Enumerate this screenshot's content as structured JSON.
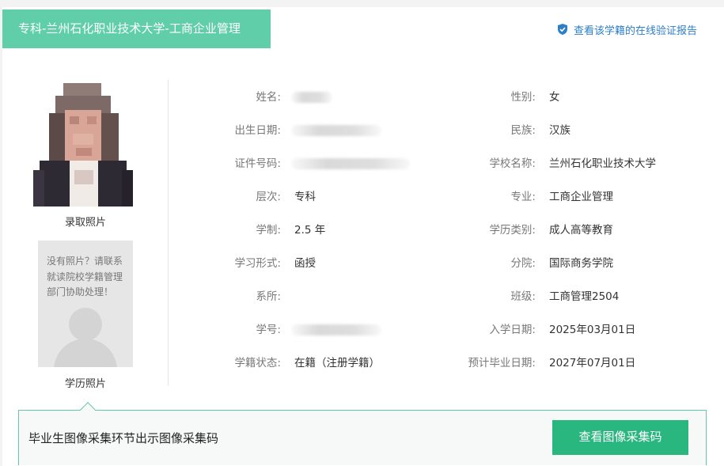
{
  "header": {
    "title": "专科-兰州石化职业技术大学-工商企业管理",
    "verify_link": "查看该学籍的在线验证报告",
    "verify_icon": "shield-check-icon"
  },
  "photos": {
    "admission_caption": "录取照片",
    "education_caption": "学历照片",
    "no_photo_msg": "没有照片？请联系就读院校学籍管理部门协助处理！"
  },
  "fields": {
    "name_label": "姓名:",
    "gender_label": "性别:",
    "gender_value": "女",
    "birth_label": "出生日期:",
    "ethnicity_label": "民族:",
    "ethnicity_value": "汉族",
    "id_label": "证件号码:",
    "school_label": "学校名称:",
    "school_value": "兰州石化职业技术大学",
    "level_label": "层次:",
    "level_value": "专科",
    "major_label": "专业:",
    "major_value": "工商企业管理",
    "duration_label": "学制:",
    "duration_value": "2.5 年",
    "edu_type_label": "学历类别:",
    "edu_type_value": "成人高等教育",
    "study_form_label": "学习形式:",
    "study_form_value": "函授",
    "branch_label": "分院:",
    "branch_value": "国际商务学院",
    "dept_label": "系所:",
    "class_label": "班级:",
    "class_value": "工商管理2504",
    "student_no_label": "学号:",
    "enroll_date_label": "入学日期:",
    "enroll_date_value": "2025年03月01日",
    "status_label": "学籍状态:",
    "status_value": "在籍（注册学籍）",
    "grad_date_label": "预计毕业日期:",
    "grad_date_value": "2027年07月01日"
  },
  "bottom": {
    "text": "毕业生图像采集环节出示图像采集码",
    "button": "查看图像采集码"
  },
  "colors": {
    "accent": "#5fcea9",
    "button": "#2ab67f",
    "link": "#2d7ec9"
  }
}
